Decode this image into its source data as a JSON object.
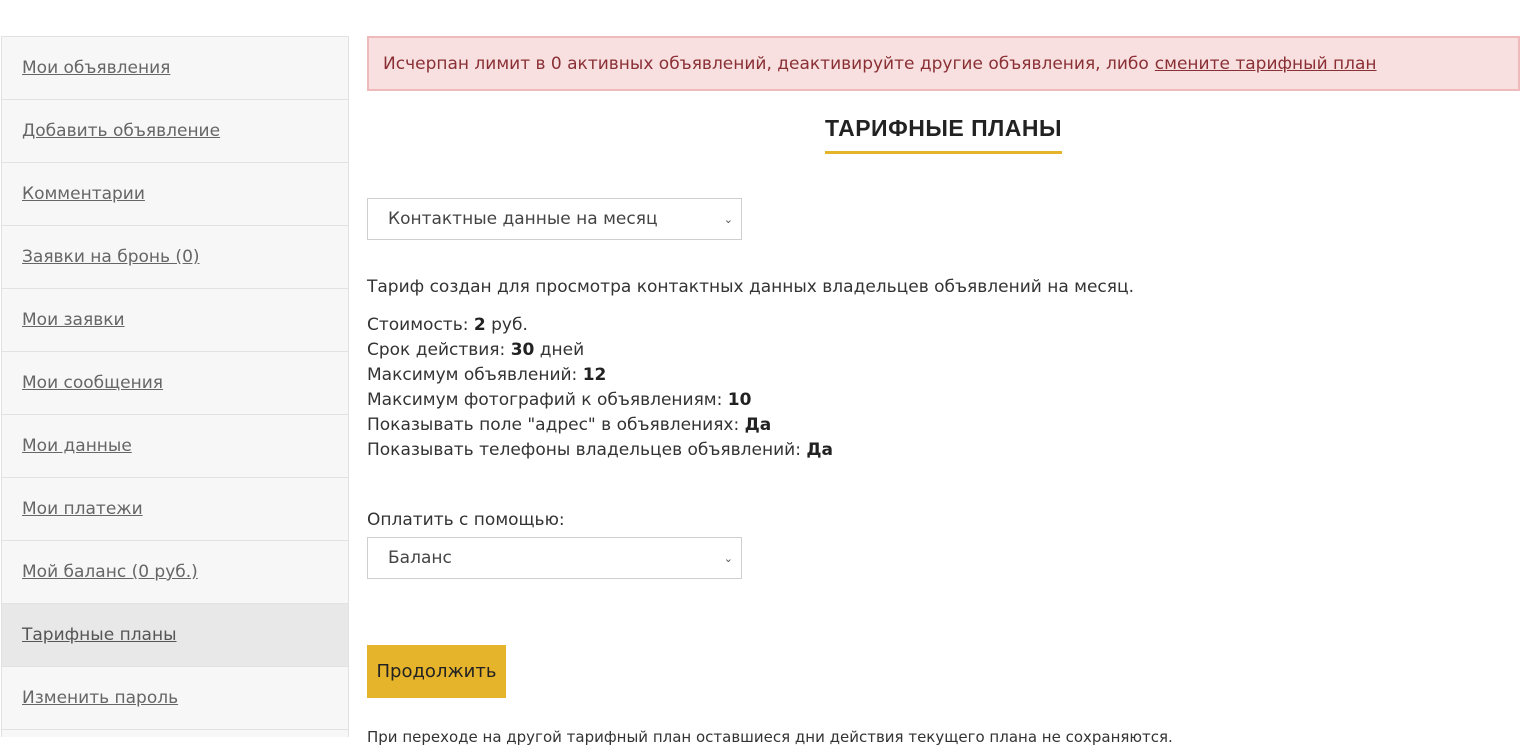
{
  "sidebar": {
    "items": [
      {
        "label": "Мои объявления"
      },
      {
        "label": "Добавить объявление"
      },
      {
        "label": "Комментарии"
      },
      {
        "label": "Заявки на бронь (0)"
      },
      {
        "label": "Мои заявки"
      },
      {
        "label": "Мои сообщения"
      },
      {
        "label": "Мои данные"
      },
      {
        "label": "Мои платежи"
      },
      {
        "label": "Мой баланс (0 руб.)"
      },
      {
        "label": "Тарифные планы",
        "active": true
      },
      {
        "label": "Изменить пароль"
      }
    ]
  },
  "alert": {
    "text": "Исчерпан лимит в 0 активных объявлений, деактивируйте другие объявления, либо",
    "link": "смените тарифный план"
  },
  "heading": "ТАРИФНЫЕ ПЛАНЫ",
  "plan_select": {
    "selected": "Контактные данные на месяц"
  },
  "description": "Тариф создан для просмотра контактных данных владельцев объявлений на месяц.",
  "plan_info": {
    "cost_label": "Стоимость:",
    "cost_value": "2",
    "cost_unit": "руб.",
    "duration_label": "Срок действия:",
    "duration_value": "30",
    "duration_unit": "дней",
    "max_ads_label": "Максимум объявлений:",
    "max_ads_value": "12",
    "max_photos_label": "Максимум фотографий к объявлениям:",
    "max_photos_value": "10",
    "address_label": "Показывать поле \"адрес\" в объявлениях:",
    "address_value": "Да",
    "phones_label": "Показывать телефоны владельцев объявлений:",
    "phones_value": "Да"
  },
  "payment": {
    "label": "Оплатить с помощью:",
    "selected": "Баланс"
  },
  "continue_button": "Продолжить",
  "footer_note": "При переходе на другой тарифный план оставшиеся дни действия текущего плана не сохраняются."
}
